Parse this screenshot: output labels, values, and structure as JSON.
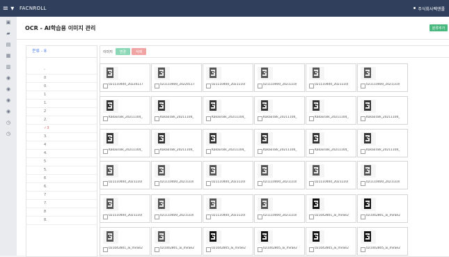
{
  "app": {
    "brand": "FACNROLL",
    "company": "주식회사팩앤롤",
    "menu_icon": "≡ ▾"
  },
  "page": {
    "title": "OCR - AI학습용 이미지 관리",
    "top_button": "분류추가"
  },
  "sidebar": {
    "icons": [
      "dashboard-icon",
      "folder-icon",
      "list-icon",
      "grid-icon",
      "archive-icon",
      "eye-icon",
      "eye-icon",
      "eye-icon",
      "eye-icon",
      "clock-icon",
      "clock-icon"
    ]
  },
  "categories": {
    "header": "분류 - 8",
    "items": [
      {
        "label": "-"
      },
      {
        "label": "0"
      },
      {
        "label": "0."
      },
      {
        "label": "1"
      },
      {
        "label": "1."
      },
      {
        "label": "2"
      },
      {
        "label": "2."
      },
      {
        "label": "✓3",
        "active": true
      },
      {
        "label": "3."
      },
      {
        "label": "4"
      },
      {
        "label": "4."
      },
      {
        "label": "5"
      },
      {
        "label": "5."
      },
      {
        "label": "6"
      },
      {
        "label": "6."
      },
      {
        "label": "7"
      },
      {
        "label": "7."
      },
      {
        "label": "8"
      },
      {
        "label": "8."
      }
    ]
  },
  "toolbar": {
    "label": "이미지",
    "edit": "변경",
    "delete": "삭제"
  },
  "images": {
    "rows": [
      [
        "021110400_20220117",
        "021110400_20220117",
        "021110400_2021110/",
        "021110400_2021110/",
        "021110400_2021110/",
        "021110400_2021110/"
      ],
      [
        "KakaoTalk_20211104_",
        "KakaoTalk_20211104_",
        "KakaoTalk_20211104_",
        "KakaoTalk_20211104_",
        "KakaoTalk_20211104_",
        "KakaoTalk_20211104_"
      ],
      [
        "KakaoTalk_20211104_",
        "KakaoTalk_20211104_",
        "KakaoTalk_20211104_",
        "KakaoTalk_20211104_",
        "KakaoTalk_20211104_",
        "KakaoTalk_20211104_"
      ],
      [
        "021110400_2021110/",
        "021110400_2021110/",
        "021110400_2021110/",
        "021110400_2021110/",
        "021110400_2021110/",
        "021110400_2021110/"
      ],
      [
        "021110400_2021110/",
        "021110400_2021110/",
        "021110400_2021110/",
        "021110400_2021110/",
        "021042801_ai_mirae2",
        "021042801_ai_mirae2"
      ],
      [
        "021042801_ai_mirae2",
        "021042801_ai_mirae2",
        "021042805_ai_mirae2",
        "021042805_ai_mirae2",
        "021042805_ai_mirae2",
        "021042805_ai_mirae2"
      ]
    ]
  }
}
